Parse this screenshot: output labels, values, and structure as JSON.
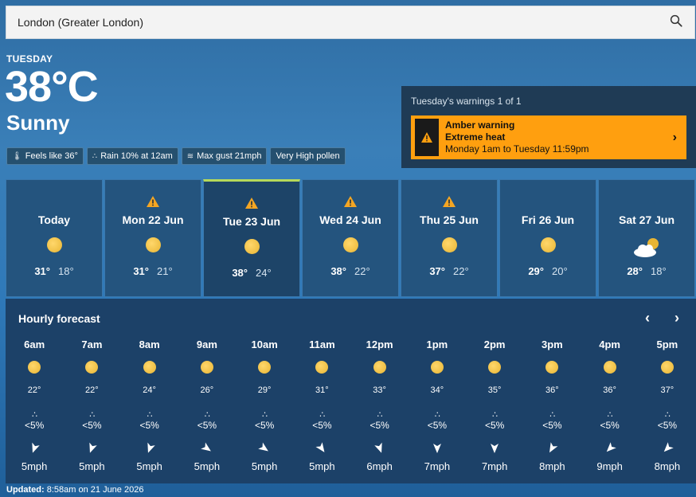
{
  "search": {
    "value": "London (Greater London)"
  },
  "current": {
    "day": "TUESDAY",
    "temperature": "38°C",
    "condition": "Sunny",
    "chips": [
      {
        "icon": "thermometer-icon",
        "label": "Feels like 36°"
      },
      {
        "icon": "raindrop-icon",
        "label": "Rain 10% at 12am"
      },
      {
        "icon": "wind-icon",
        "label": "Max gust 21mph"
      },
      {
        "icon": "",
        "label": "Very High pollen"
      }
    ]
  },
  "warnings": {
    "title": "Tuesday's warnings 1 of 1",
    "level": "Amber warning",
    "type": "Extreme heat",
    "period": "Monday 1am to Tuesday 11:59pm",
    "color": "#ff9f0f"
  },
  "days": [
    {
      "name": "Today",
      "hi": "31°",
      "lo": "18°",
      "warning": false,
      "icon": "sun-icon",
      "active": false
    },
    {
      "name": "Mon 22 Jun",
      "hi": "31°",
      "lo": "21°",
      "warning": true,
      "icon": "sun-icon",
      "active": false
    },
    {
      "name": "Tue 23 Jun",
      "hi": "38°",
      "lo": "24°",
      "warning": true,
      "icon": "sun-icon",
      "active": true
    },
    {
      "name": "Wed 24 Jun",
      "hi": "38°",
      "lo": "22°",
      "warning": true,
      "icon": "sun-icon",
      "active": false
    },
    {
      "name": "Thu 25 Jun",
      "hi": "37°",
      "lo": "22°",
      "warning": true,
      "icon": "sun-icon",
      "active": false
    },
    {
      "name": "Fri 26 Jun",
      "hi": "29°",
      "lo": "20°",
      "warning": false,
      "icon": "sun-icon",
      "active": false
    },
    {
      "name": "Sat 27 Jun",
      "hi": "28°",
      "lo": "18°",
      "warning": false,
      "icon": "sun-cloud-icon",
      "active": false
    }
  ],
  "hourly": {
    "title": "Hourly forecast",
    "prev": "‹",
    "next": "›",
    "hours": [
      {
        "time": "6am",
        "temp": "22°",
        "rain": "<5%",
        "wind": "5mph",
        "dir": 200
      },
      {
        "time": "7am",
        "temp": "22°",
        "rain": "<5%",
        "wind": "5mph",
        "dir": 200
      },
      {
        "time": "8am",
        "temp": "24°",
        "rain": "<5%",
        "wind": "5mph",
        "dir": 200
      },
      {
        "time": "9am",
        "temp": "26°",
        "rain": "<5%",
        "wind": "5mph",
        "dir": 125
      },
      {
        "time": "10am",
        "temp": "29°",
        "rain": "<5%",
        "wind": "5mph",
        "dir": 125
      },
      {
        "time": "11am",
        "temp": "31°",
        "rain": "<5%",
        "wind": "5mph",
        "dir": 145
      },
      {
        "time": "12pm",
        "temp": "33°",
        "rain": "<5%",
        "wind": "6mph",
        "dir": 160
      },
      {
        "time": "1pm",
        "temp": "34°",
        "rain": "<5%",
        "wind": "7mph",
        "dir": 180
      },
      {
        "time": "2pm",
        "temp": "35°",
        "rain": "<5%",
        "wind": "7mph",
        "dir": 180
      },
      {
        "time": "3pm",
        "temp": "36°",
        "rain": "<5%",
        "wind": "8mph",
        "dir": 210
      },
      {
        "time": "4pm",
        "temp": "36°",
        "rain": "<5%",
        "wind": "9mph",
        "dir": 225
      },
      {
        "time": "5pm",
        "temp": "37°",
        "rain": "<5%",
        "wind": "8mph",
        "dir": 225
      }
    ]
  },
  "updated": {
    "label": "Updated:",
    "value": "8:58am on 21 June 2026"
  }
}
